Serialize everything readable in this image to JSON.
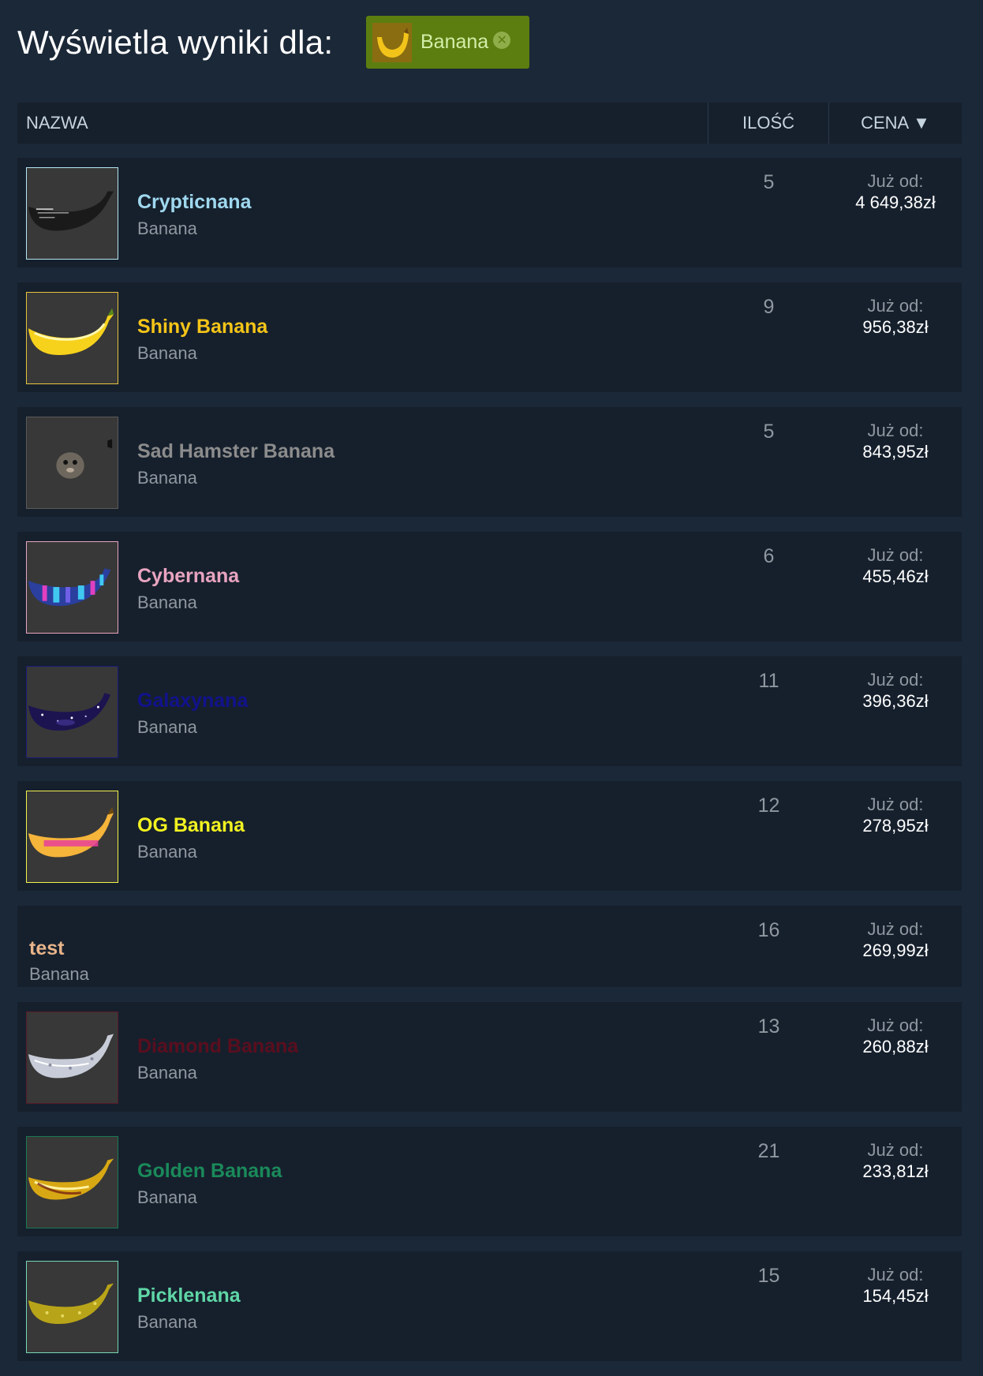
{
  "header": {
    "title": "Wyświetla wyniki dla:"
  },
  "filter": {
    "label": "Banana",
    "close_glyph": "✕",
    "icon": "banana-icon"
  },
  "table": {
    "columns": {
      "name": "NAZWA",
      "quantity": "ILOŚĆ",
      "price": "CENA ▼"
    }
  },
  "price_prefix": "Już od:",
  "items": [
    {
      "name": "Crypticnana",
      "game": "Banana",
      "quantity": "5",
      "price": "4 649,38zł",
      "name_color": "#9fd8ef",
      "border_color": "#b6e6f4",
      "image": "crypticnana-banana-image"
    },
    {
      "name": "Shiny Banana",
      "game": "Banana",
      "quantity": "9",
      "price": "956,38zł",
      "name_color": "#f5c518",
      "border_color": "#e8c33c",
      "image": "shiny-banana-image"
    },
    {
      "name": "Sad Hamster Banana",
      "game": "Banana",
      "quantity": "5",
      "price": "843,95zł",
      "name_color": "#8c8c8c",
      "border_color": "#5a5a5a",
      "image": "sad-hamster-banana-image"
    },
    {
      "name": "Cybernana",
      "game": "Banana",
      "quantity": "6",
      "price": "455,46zł",
      "name_color": "#e8a4c0",
      "border_color": "#e8a4c0",
      "image": "cybernana-banana-image"
    },
    {
      "name": "Galaxynana",
      "game": "Banana",
      "quantity": "11",
      "price": "396,36zł",
      "name_color": "#12128c",
      "border_color": "#1a1a7a",
      "image": "galaxynana-banana-image"
    },
    {
      "name": "OG Banana",
      "game": "Banana",
      "quantity": "12",
      "price": "278,95zł",
      "name_color": "#f2f220",
      "border_color": "#f2f24a",
      "image": "og-banana-image"
    },
    {
      "name": "test",
      "game": "Banana",
      "quantity": "16",
      "price": "269,99zł",
      "name_color": "#e8b48a",
      "border_color": "",
      "image": ""
    },
    {
      "name": "Diamond Banana",
      "game": "Banana",
      "quantity": "13",
      "price": "260,88zł",
      "name_color": "#5a0e1e",
      "border_color": "#5a1a28",
      "image": "diamond-banana-image"
    },
    {
      "name": "Golden Banana",
      "game": "Banana",
      "quantity": "21",
      "price": "233,81zł",
      "name_color": "#1a8a5a",
      "border_color": "#1a7a52",
      "image": "golden-banana-image"
    },
    {
      "name": "Picklenana",
      "game": "Banana",
      "quantity": "15",
      "price": "154,45zł",
      "name_color": "#5fd6a6",
      "border_color": "#7ad6b4",
      "image": "picklenana-banana-image"
    }
  ]
}
